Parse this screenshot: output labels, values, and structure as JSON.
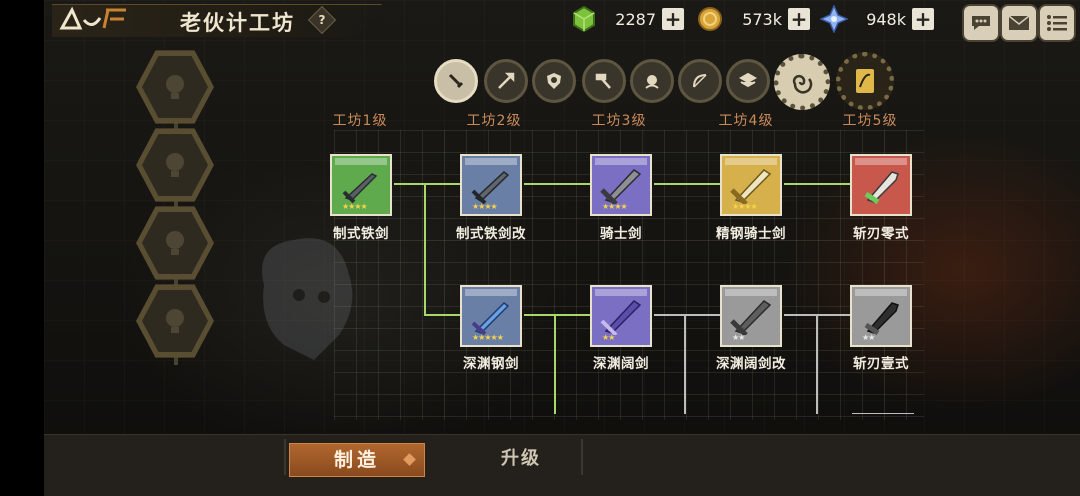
{
  "title": "老伙计工坊",
  "help_icon": "?",
  "currencies": [
    {
      "icon": "green-gem-icon",
      "value": "2287"
    },
    {
      "icon": "gold-coin-icon",
      "value": "573k"
    },
    {
      "icon": "blue-crystal-icon",
      "value": "948k"
    }
  ],
  "top_icons": [
    "chat-icon",
    "mail-icon",
    "menu-list-icon"
  ],
  "categories": [
    "dagger-icon",
    "spear-icon",
    "shield-icon",
    "hammer-icon",
    "orb-icon",
    "bow-icon",
    "scroll-icon",
    "swirl-icon",
    "card-icon"
  ],
  "levels": [
    "工坊1级",
    "工坊2级",
    "工坊3级",
    "工坊4级",
    "工坊5级"
  ],
  "weapons_row1": [
    {
      "name": "制式铁剑",
      "color": "#5faa4c",
      "stars": "★★★★"
    },
    {
      "name": "制式铁剑改",
      "color": "#6a7fa6",
      "stars": "★★★★"
    },
    {
      "name": "骑士剑",
      "color": "#7b6fc4",
      "stars": "★★★★"
    },
    {
      "name": "精钢骑士剑",
      "color": "#d6b04a",
      "stars": "★★★★"
    },
    {
      "name": "斩刃零式",
      "color": "#c8574c",
      "stars": ""
    }
  ],
  "weapons_row2": [
    {
      "name": "深渊钢剑",
      "color": "#6a7fa6",
      "stars": "★★★★★"
    },
    {
      "name": "深渊阔剑",
      "color": "#7b6fc4",
      "stars": "★★"
    },
    {
      "name": "深渊阔剑改",
      "color": "#9a9a9a",
      "stars": "★★"
    },
    {
      "name": "斩刃壹式",
      "color": "#9a9a9a",
      "stars": "★★"
    }
  ],
  "tabs": {
    "make": "制造",
    "upgrade": "升级"
  }
}
